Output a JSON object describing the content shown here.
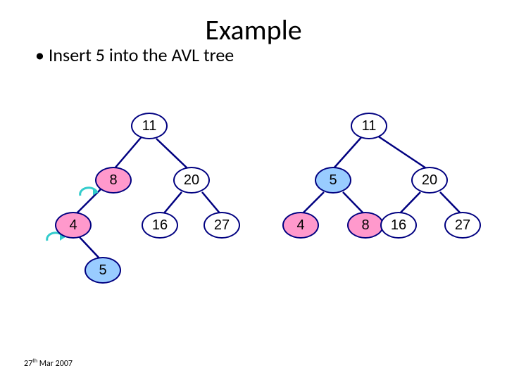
{
  "title": "Example",
  "bullet_text": "Insert 5 into the AVL tree",
  "footer": {
    "day": "27",
    "ord": "th",
    "rest": " Mar 2007"
  },
  "colors": {
    "node_border": "#000080",
    "edge": "#000080",
    "highlight_pink": "#ff99cc",
    "highlight_blue": "#99ccff",
    "rotation_arrow": "#33cccc"
  },
  "left_tree": {
    "root": "11",
    "l": "8",
    "r": "20",
    "ll": "4",
    "rl": "16",
    "rr": "27",
    "lll": "5"
  },
  "right_tree": {
    "root": "11",
    "l": "5",
    "r": "20",
    "ll": "4",
    "lr": "8",
    "rl": "16",
    "rr": "27"
  },
  "chart_data": {
    "type": "tree",
    "description": "AVL tree before and after inserting 5 with rotation",
    "before": {
      "value": 11,
      "color": "white",
      "left": {
        "value": 8,
        "color": "pink",
        "left": {
          "value": 4,
          "color": "pink",
          "left": {
            "value": 5,
            "color": "blue"
          }
        }
      },
      "right": {
        "value": 20,
        "color": "white",
        "left": {
          "value": 16,
          "color": "white"
        },
        "right": {
          "value": 27,
          "color": "white"
        }
      }
    },
    "after": {
      "value": 11,
      "color": "white",
      "left": {
        "value": 5,
        "color": "blue",
        "left": {
          "value": 4,
          "color": "pink"
        },
        "right": {
          "value": 8,
          "color": "pink"
        }
      },
      "right": {
        "value": 20,
        "color": "white",
        "left": {
          "value": 16,
          "color": "white"
        },
        "right": {
          "value": 27,
          "color": "white"
        }
      }
    },
    "rotation_arrows": [
      "at node 8 (counter-clockwise)",
      "at node 4 (counter-clockwise)"
    ]
  }
}
